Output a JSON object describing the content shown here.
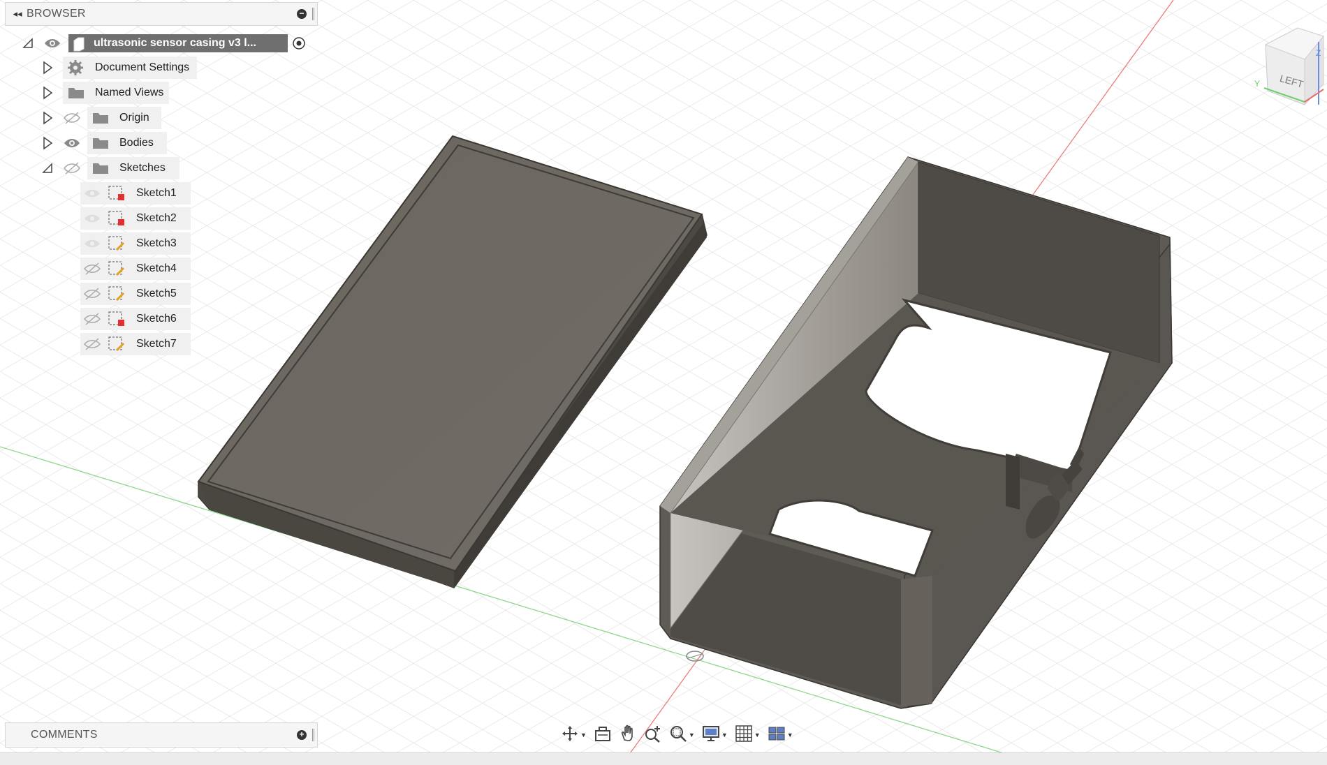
{
  "browser": {
    "title": "BROWSER",
    "collapse_glyph": "◂◂",
    "root": {
      "label": "ultrasonic sensor casing v3 l..."
    },
    "folders": [
      {
        "label": "Document Settings",
        "icon": "gear-icon"
      },
      {
        "label": "Named Views",
        "icon": "folder-icon"
      },
      {
        "label": "Origin",
        "icon": "folder-icon"
      },
      {
        "label": "Bodies",
        "icon": "folder-icon"
      },
      {
        "label": "Sketches",
        "icon": "folder-icon"
      }
    ],
    "sketches": [
      "Sketch1",
      "Sketch2",
      "Sketch3",
      "Sketch4",
      "Sketch5",
      "Sketch6",
      "Sketch7"
    ]
  },
  "comments": {
    "title": "COMMENTS"
  },
  "viewcube": {
    "face_label": "LEFT",
    "axis_y": "Y",
    "axis_z": "Z"
  },
  "toolbar": {
    "buttons": [
      "orbit-icon",
      "look-at-icon",
      "pan-icon",
      "zoom-icon",
      "fit-icon",
      "display-settings-icon",
      "grid-settings-icon",
      "viewports-icon"
    ]
  },
  "colors": {
    "model": "#6a6660",
    "grid_line": "#dcdcdc",
    "x_axis": "#e85c5c",
    "y_axis": "#7fd07f"
  }
}
